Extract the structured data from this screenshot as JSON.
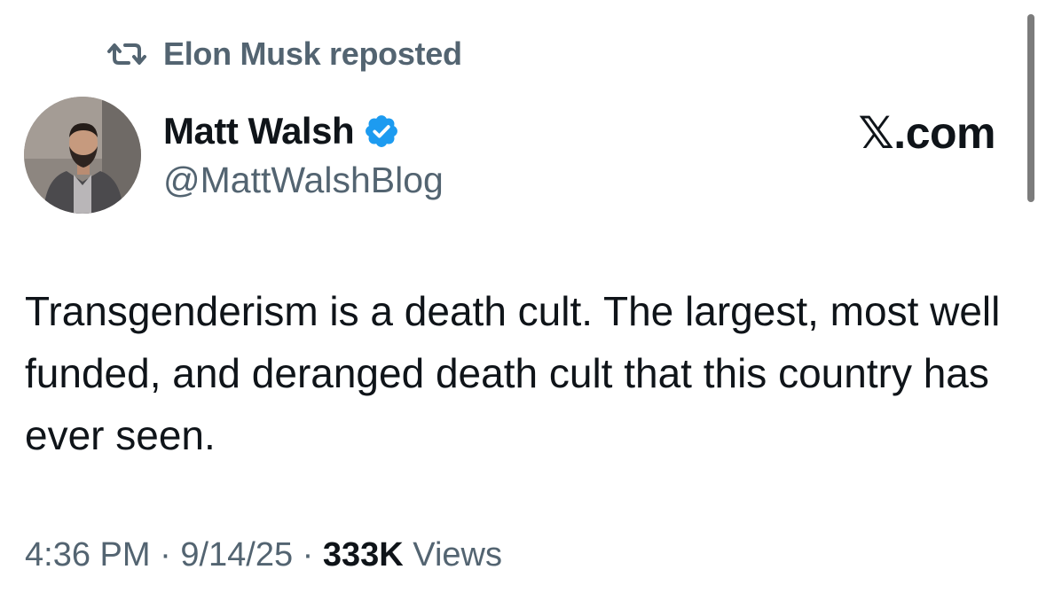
{
  "repost": {
    "icon": "repost-icon",
    "text": "Elon Musk reposted"
  },
  "author": {
    "avatar_icon": "avatar",
    "display_name": "Matt Walsh",
    "verified_icon": "verified-badge-icon",
    "verified_color": "#1d9bf0",
    "handle": "@MattWalshBlog"
  },
  "brand": {
    "label": "𝕏.com"
  },
  "tweet": {
    "text": "Transgenderism is a death cult. The largest, most well funded, and deranged death cult that this country has ever seen."
  },
  "meta": {
    "time": "4:36 PM",
    "sep1": " · ",
    "date": "9/14/25",
    "sep2": " · ",
    "views_count": "333K",
    "views_label": " Views"
  },
  "colors": {
    "text": "#0f1419",
    "secondary": "#536471",
    "background": "#ffffff"
  }
}
